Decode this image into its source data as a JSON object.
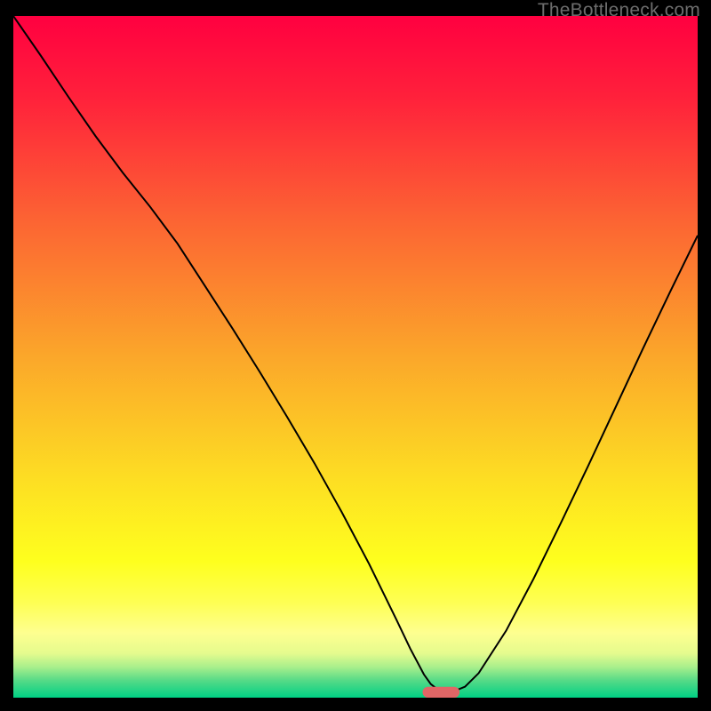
{
  "watermark": "TheBottleneck.com",
  "chart_data": {
    "type": "line",
    "title": "",
    "xlabel": "",
    "ylabel": "",
    "xlim": [
      0,
      100
    ],
    "ylim": [
      0,
      100
    ],
    "grid": false,
    "background_gradient": {
      "orientation": "vertical",
      "stops": [
        {
          "offset": 0.0,
          "color": "#ff0040"
        },
        {
          "offset": 0.12,
          "color": "#ff213b"
        },
        {
          "offset": 0.3,
          "color": "#fc6433"
        },
        {
          "offset": 0.5,
          "color": "#fba72a"
        },
        {
          "offset": 0.68,
          "color": "#fdde23"
        },
        {
          "offset": 0.8,
          "color": "#feff1e"
        },
        {
          "offset": 0.86,
          "color": "#feff53"
        },
        {
          "offset": 0.905,
          "color": "#feff90"
        },
        {
          "offset": 0.935,
          "color": "#e5fb8e"
        },
        {
          "offset": 0.955,
          "color": "#a9ef8c"
        },
        {
          "offset": 0.975,
          "color": "#55da87"
        },
        {
          "offset": 1.0,
          "color": "#00d084"
        }
      ]
    },
    "series": [
      {
        "name": "curve",
        "color": "#000000",
        "stroke_width": 2,
        "x": [
          0,
          4,
          8,
          12,
          16,
          20,
          24,
          28,
          32,
          36,
          40,
          44,
          48,
          52,
          56,
          58,
          60,
          61,
          62,
          63,
          64,
          66,
          68,
          72,
          76,
          80,
          84,
          88,
          92,
          96,
          100
        ],
        "y": [
          100,
          94.2,
          88.2,
          82.4,
          77.0,
          72.0,
          66.6,
          60.4,
          54.2,
          47.8,
          41.2,
          34.4,
          27.2,
          19.6,
          11.4,
          7.2,
          3.4,
          2.0,
          1.2,
          0.8,
          0.8,
          1.6,
          3.6,
          9.8,
          17.4,
          25.6,
          34.0,
          42.6,
          51.2,
          59.6,
          67.8
        ]
      }
    ],
    "marker": {
      "name": "optimal-pill",
      "x_center": 62.5,
      "y": 0.8,
      "width_x_units": 5.4,
      "height_y_units": 1.6,
      "color": "#e06666"
    }
  }
}
